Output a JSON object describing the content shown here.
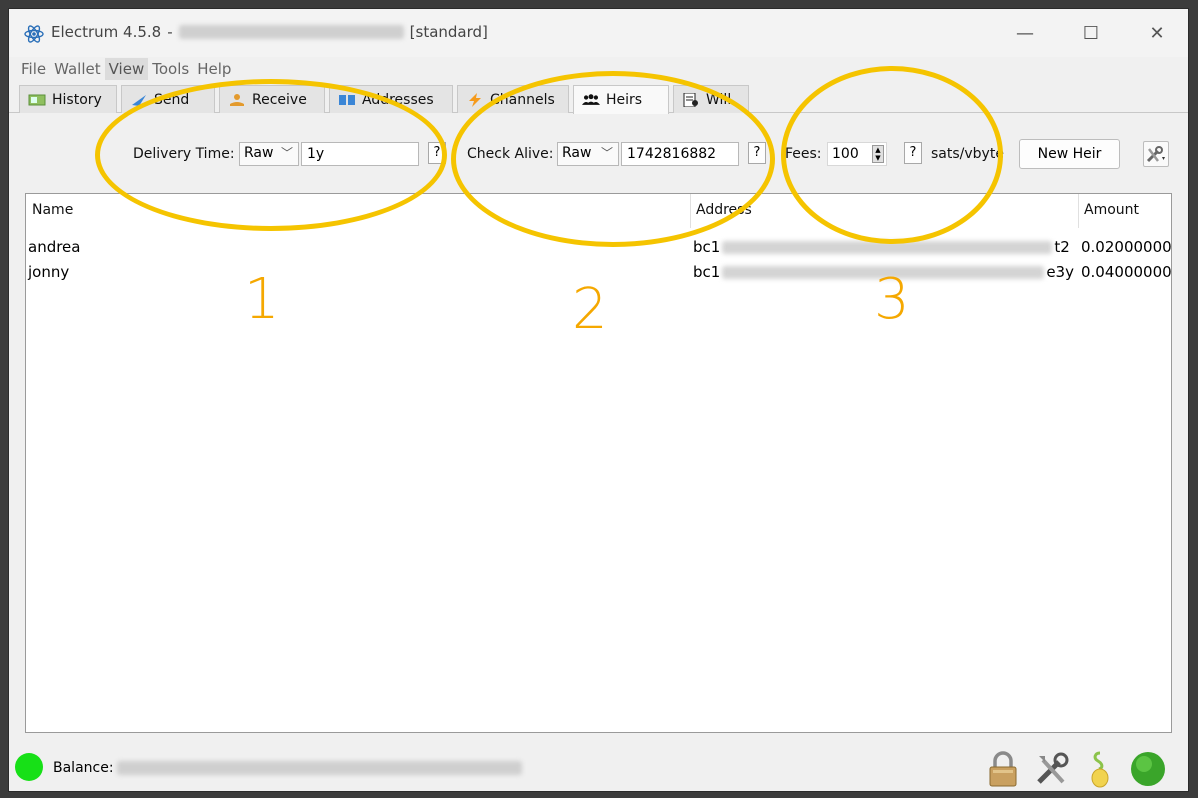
{
  "window": {
    "app_name": "Electrum 4.5.8",
    "separator": "-",
    "wallet_mode": "[standard]",
    "controls": {
      "minimize": "—",
      "maximize": "☐",
      "close": "✕"
    }
  },
  "menu": [
    "File",
    "Wallet",
    "View",
    "Tools",
    "Help"
  ],
  "tabs": [
    {
      "label": "History",
      "icon": "history-icon"
    },
    {
      "label": "Send",
      "icon": "send-icon"
    },
    {
      "label": "Receive",
      "icon": "receive-icon"
    },
    {
      "label": "Addresses",
      "icon": "addresses-icon"
    },
    {
      "label": "Channels",
      "icon": "lightning-icon"
    },
    {
      "label": "Heirs",
      "icon": "heirs-icon",
      "active": true
    },
    {
      "label": "Will",
      "icon": "will-icon"
    }
  ],
  "toolbar": {
    "delivery_time_label": "Delivery Time:",
    "delivery_time_unit": "Raw",
    "delivery_time_value": "1y",
    "check_alive_label": "Check Alive:",
    "check_alive_unit": "Raw",
    "check_alive_value": "1742816882",
    "fees_label": "Fees:",
    "fees_value": "100",
    "fees_unit": "sats/vbyte",
    "help_label": "?",
    "new_heir_label": "New Heir"
  },
  "heirs_table": {
    "columns": [
      "Name",
      "Address",
      "Amount"
    ],
    "rows": [
      {
        "name": "andrea",
        "address_prefix": "bc1",
        "address_suffix": "t2",
        "amount": "0.02000000"
      },
      {
        "name": "jonny",
        "address_prefix": "bc1",
        "address_suffix": "e3y",
        "amount": "0.04000000"
      }
    ]
  },
  "annotations": [
    "1",
    "2",
    "3"
  ],
  "status": {
    "balance_label": "Balance:",
    "connection_color": "#17e017"
  },
  "colors": {
    "annotation": "#f5c400",
    "annotation_text": "#f5a800"
  }
}
